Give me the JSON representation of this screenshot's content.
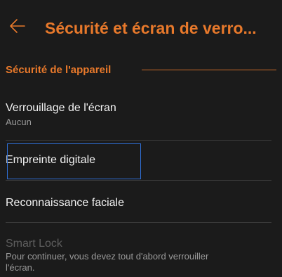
{
  "colors": {
    "accent": "#e8792b",
    "background": "#1b1b1b",
    "focus": "#2f6fd6"
  },
  "appbar": {
    "back_icon": "arrow-left-icon",
    "title": "Sécurité et écran de verro..."
  },
  "section": {
    "label": "Sécurité de l'appareil"
  },
  "items": [
    {
      "title": "Verrouillage de l'écran",
      "subtitle": "Aucun"
    },
    {
      "title": "Empreinte digitale"
    },
    {
      "title": "Reconnaissance faciale"
    },
    {
      "title": "Smart Lock",
      "subtitle_line1": "Pour continuer, vous devez tout d'abord verrouiller",
      "subtitle_line2": "l'écran."
    }
  ]
}
